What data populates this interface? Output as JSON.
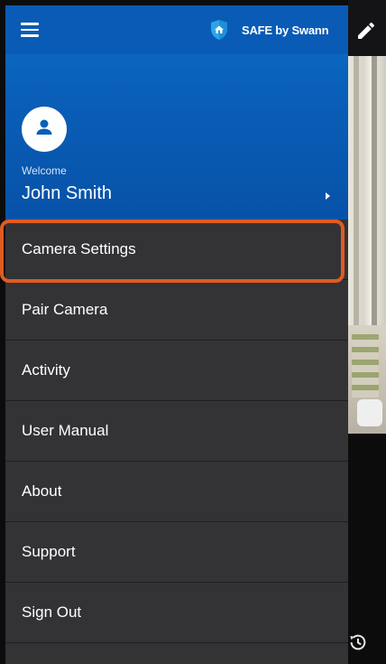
{
  "app": {
    "brand_name": "SAFE by Swann"
  },
  "profile": {
    "welcome": "Welcome",
    "name": "John Smith"
  },
  "menu": {
    "items": [
      {
        "label": "Camera Settings"
      },
      {
        "label": "Pair Camera"
      },
      {
        "label": "Activity"
      },
      {
        "label": "User Manual"
      },
      {
        "label": "About"
      },
      {
        "label": "Support"
      },
      {
        "label": "Sign Out"
      }
    ],
    "highlighted_item": "Camera Settings"
  },
  "colors": {
    "header_blue": "#0a5fb8",
    "drawer_bg": "#333336",
    "highlight": "#e05b22"
  },
  "icons": [
    "menu-icon",
    "shield-home-icon",
    "person-icon",
    "chevron-right-icon",
    "pencil-icon",
    "history-icon"
  ]
}
